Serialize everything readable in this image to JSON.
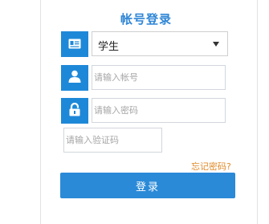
{
  "title": "帐号登录",
  "role_select": {
    "value": "学生"
  },
  "account": {
    "placeholder": "请输入帐号"
  },
  "password": {
    "placeholder": "请输入密码"
  },
  "captcha": {
    "placeholder": "请输入验证码"
  },
  "forgot_label": "忘记密码?",
  "login_label": "登录",
  "icons": {
    "role": "id-card-icon",
    "account": "user-icon",
    "password": "lock-icon"
  },
  "colors": {
    "accent": "#1e88d8",
    "title": "#2f86d6",
    "forgot": "#e08a2a"
  }
}
